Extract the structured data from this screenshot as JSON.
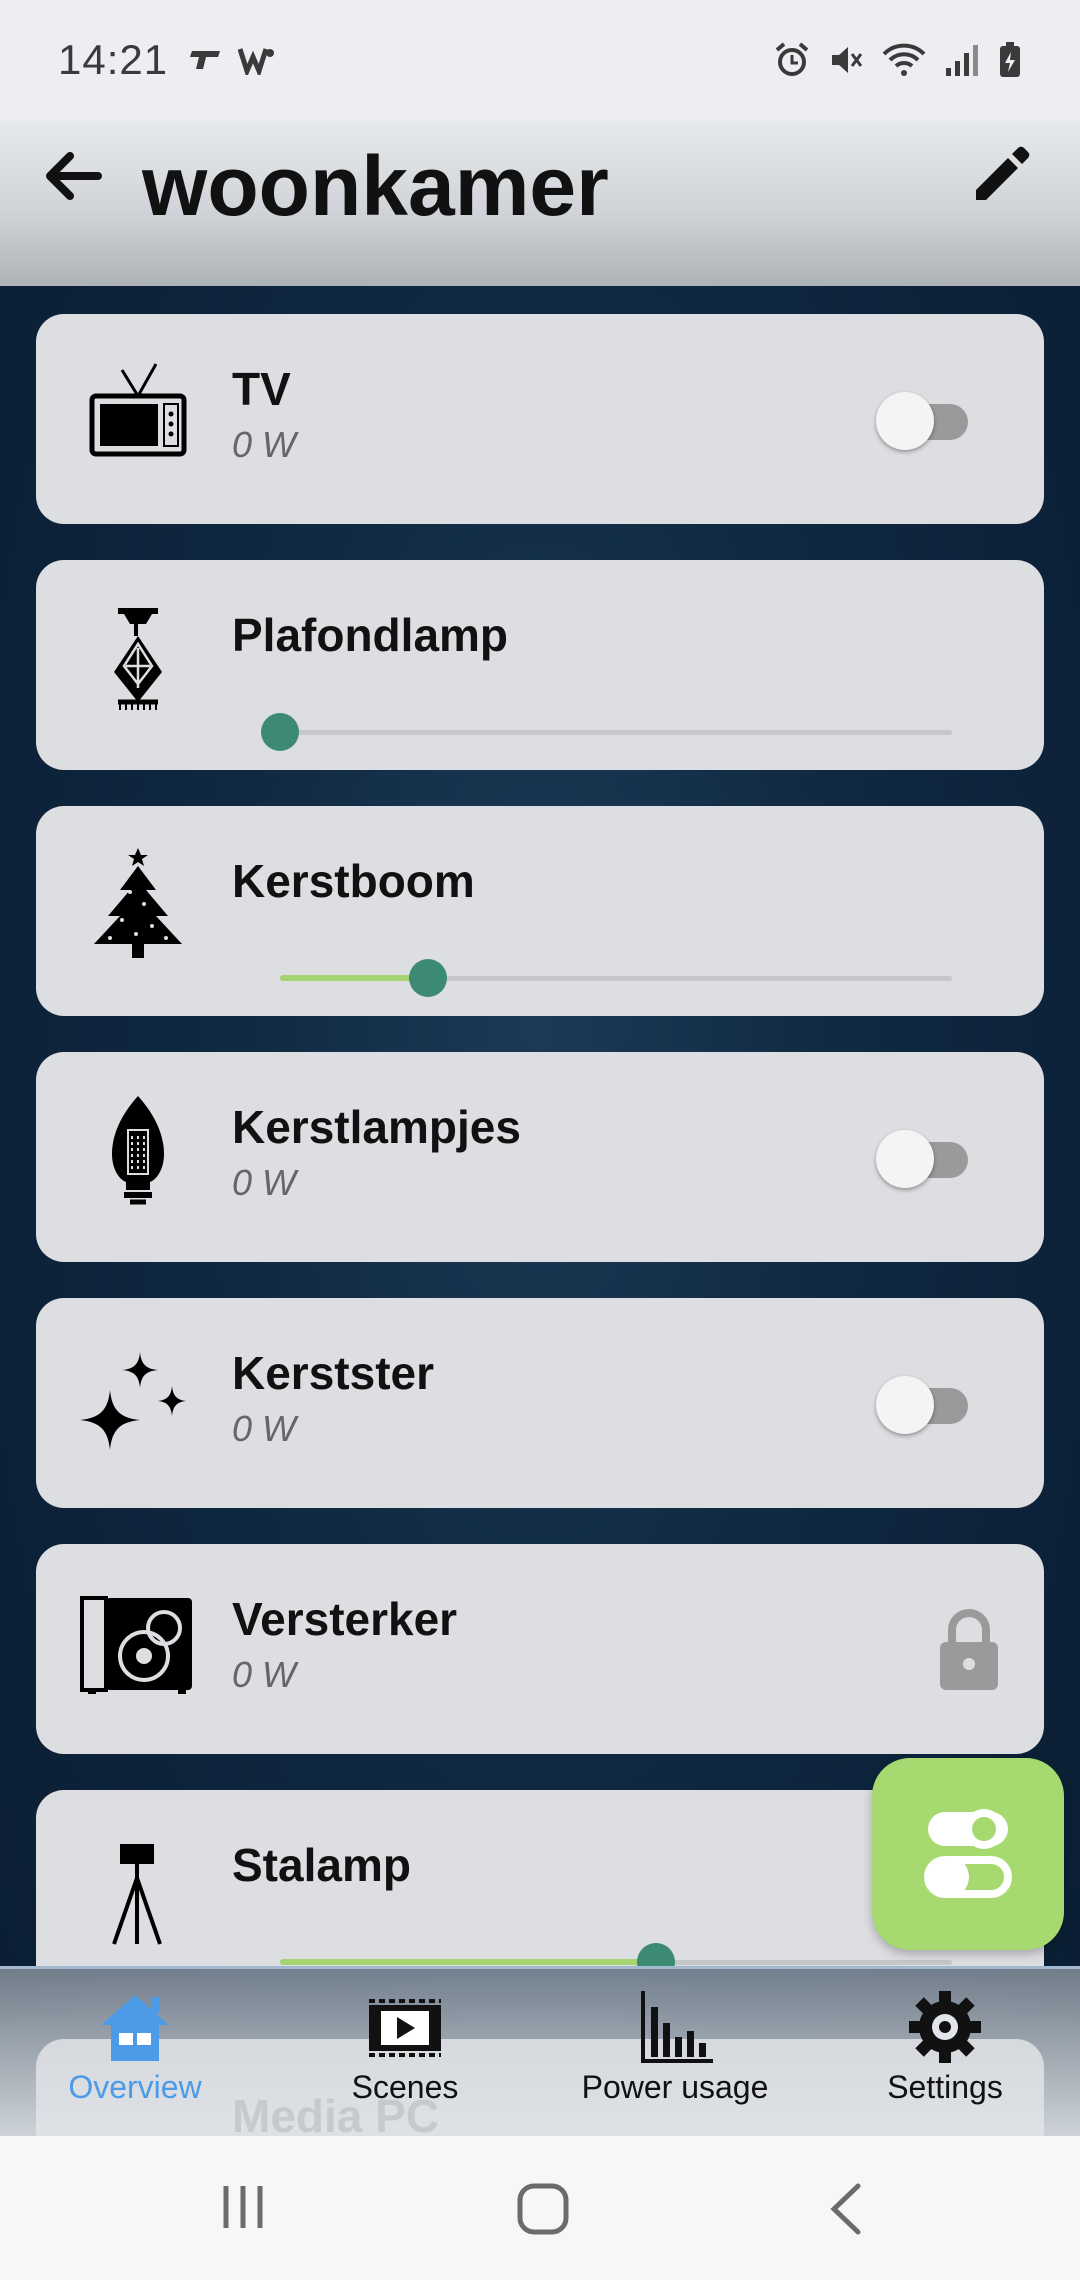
{
  "status_bar": {
    "time": "14:21"
  },
  "app_bar": {
    "title": "woonkamer"
  },
  "devices": [
    {
      "name": "TV",
      "power": "0 W",
      "control": "toggle",
      "on": false,
      "icon": "tv-icon"
    },
    {
      "name": "Plafondlamp",
      "control": "slider",
      "level": 0.0,
      "icon": "ceiling-lamp-icon"
    },
    {
      "name": "Kerstboom",
      "control": "slider",
      "level": 0.22,
      "icon": "christmas-tree-icon"
    },
    {
      "name": "Kerstlampjes",
      "power": "0 W",
      "control": "toggle",
      "on": false,
      "icon": "light-bulb-icon"
    },
    {
      "name": "Kerstster",
      "power": "0 W",
      "control": "toggle",
      "on": false,
      "icon": "sparkles-icon"
    },
    {
      "name": "Versterker",
      "power": "0 W",
      "control": "lock",
      "icon": "speaker-icon"
    },
    {
      "name": "Stalamp",
      "control": "slider",
      "level": 0.56,
      "icon": "tripod-lamp-icon"
    },
    {
      "name": "Media PC",
      "control": "lock",
      "icon": "computer-icon"
    }
  ],
  "bottom_nav": {
    "items": [
      {
        "label": "Overview",
        "icon": "home-icon",
        "active": true
      },
      {
        "label": "Scenes",
        "icon": "scenes-icon",
        "active": false
      },
      {
        "label": "Power usage",
        "icon": "bar-chart-icon",
        "active": false
      },
      {
        "label": "Settings",
        "icon": "gear-icon",
        "active": false
      }
    ]
  },
  "colors": {
    "accent": "#3d8a74",
    "slider_fill": "#a5d46f",
    "fab": "#a6d96f",
    "nav_active": "#4d9be6",
    "card": "#dcdee1"
  }
}
